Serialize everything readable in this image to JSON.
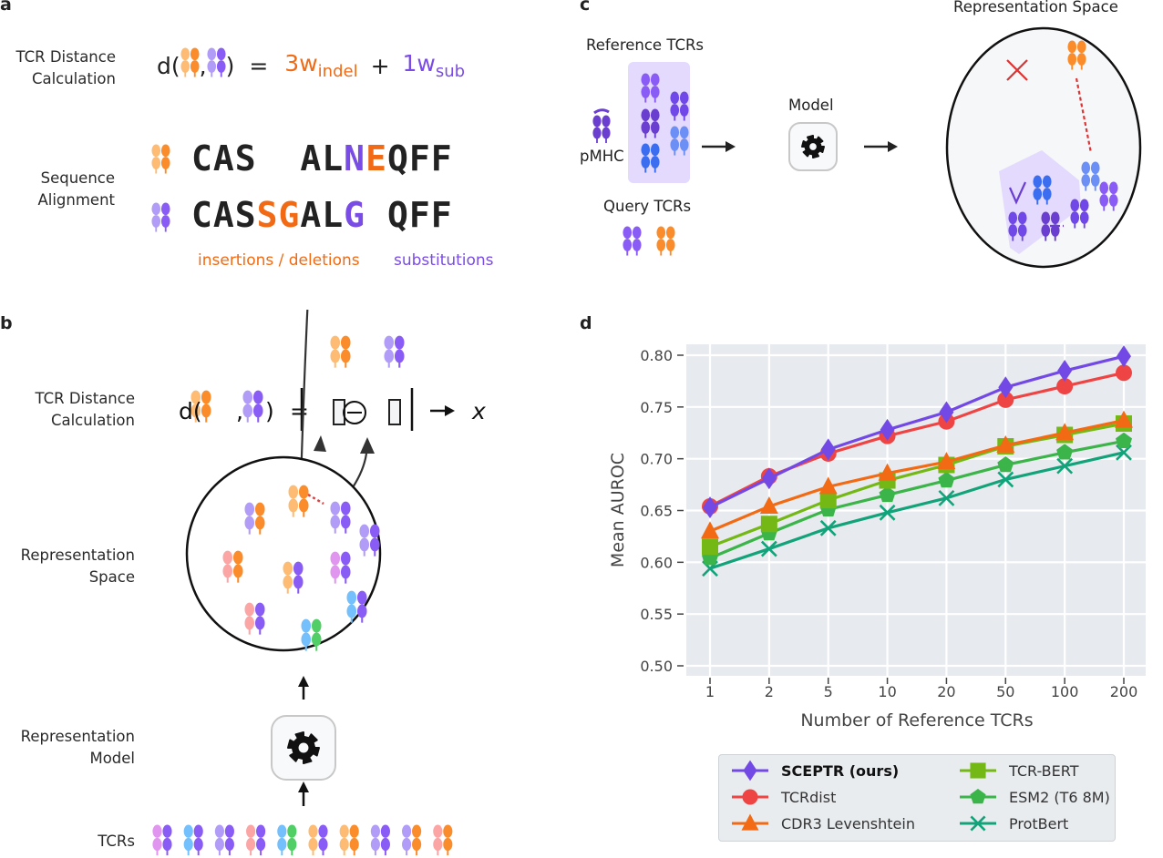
{
  "panels": {
    "a": {
      "label": "a",
      "row_labels": [
        "TCR Distance\nCalculation",
        "Sequence\nAlignment"
      ],
      "formula": {
        "prefix": "d(",
        "sep": ",",
        "suffix": ")",
        "equals": "=",
        "term1_coef": "3w",
        "term1_sub": "indel",
        "plus": "+",
        "term2_coef": "1w",
        "term2_sub": "sub"
      },
      "alignment": {
        "seq1": [
          {
            "t": "CAS",
            "c": "k"
          },
          {
            "t": "  ",
            "c": "k"
          },
          {
            "t": "AL",
            "c": "k"
          },
          {
            "t": "N",
            "c": "p"
          },
          {
            "t": "E",
            "c": "o"
          },
          {
            "t": "QFF",
            "c": "k"
          }
        ],
        "seq2": [
          {
            "t": "CAS",
            "c": "k"
          },
          {
            "t": "SG",
            "c": "o"
          },
          {
            "t": "AL",
            "c": "k"
          },
          {
            "t": "G",
            "c": "p"
          },
          {
            "t": " ",
            "c": "k"
          },
          {
            "t": "QFF",
            "c": "k"
          }
        ]
      },
      "annot_indel": "insertions / deletions",
      "annot_sub": "substitutions"
    },
    "b": {
      "label": "b",
      "row_labels": [
        "TCR Distance\nCalculation",
        "Representation\nSpace",
        "Representation\nModel",
        "TCRs"
      ],
      "formula_result": "x"
    },
    "c": {
      "label": "c",
      "reference_title": "Reference TCRs",
      "pmhc_label": "pMHC",
      "query_title": "Query TCRs",
      "model_label": "Model",
      "space_title": "Representation Space"
    },
    "d": {
      "label": "d"
    }
  },
  "colors": {
    "orange": "#f26a13",
    "purple": "#7a4ce6",
    "light_orange": "#fdbb73",
    "tcr_orange": "#fb8c2b",
    "light_purple": "#b19cf7",
    "tcr_purple": "#8a5cf6",
    "dark_purple": "#6a3fd0",
    "blue": "#3a6df0",
    "light_blue": "#6b8ff5"
  },
  "chart_data": {
    "type": "line",
    "title": "",
    "xlabel": "Number of Reference TCRs",
    "ylabel": "Mean AUROC",
    "categories": [
      "1",
      "2",
      "5",
      "10",
      "20",
      "50",
      "100",
      "200"
    ],
    "ylim": [
      0.5,
      0.82
    ],
    "yticks": [
      "0.50",
      "0.55",
      "0.60",
      "0.65",
      "0.70",
      "0.75",
      "0.80"
    ],
    "grid": true,
    "legend_position": "bottom-below",
    "series": [
      {
        "name": "SCEPTR (ours)",
        "bold": true,
        "color": "#7349e6",
        "marker": "diamond",
        "values": [
          0.653,
          0.681,
          0.709,
          0.728,
          0.745,
          0.769,
          0.785,
          0.799
        ]
      },
      {
        "name": "TCRdist",
        "bold": false,
        "color": "#ef4444",
        "marker": "circle",
        "values": [
          0.654,
          0.683,
          0.705,
          0.722,
          0.736,
          0.757,
          0.77,
          0.783
        ]
      },
      {
        "name": "CDR3 Levenshtein",
        "bold": false,
        "color": "#f26a13",
        "marker": "triangle",
        "values": [
          0.63,
          0.654,
          0.673,
          0.686,
          0.697,
          0.713,
          0.725,
          0.737
        ]
      },
      {
        "name": "TCR-BERT",
        "bold": false,
        "color": "#74b816",
        "marker": "square",
        "values": [
          0.615,
          0.637,
          0.66,
          0.679,
          0.694,
          0.712,
          0.723,
          0.734
        ]
      },
      {
        "name": "ESM2 (T6 8M)",
        "bold": false,
        "color": "#3bb44a",
        "marker": "pentagon",
        "values": [
          0.604,
          0.628,
          0.651,
          0.665,
          0.679,
          0.694,
          0.706,
          0.717
        ]
      },
      {
        "name": "ProtBert",
        "bold": false,
        "color": "#12a37a",
        "marker": "x",
        "values": [
          0.594,
          0.613,
          0.633,
          0.648,
          0.662,
          0.68,
          0.693,
          0.706
        ]
      }
    ]
  }
}
